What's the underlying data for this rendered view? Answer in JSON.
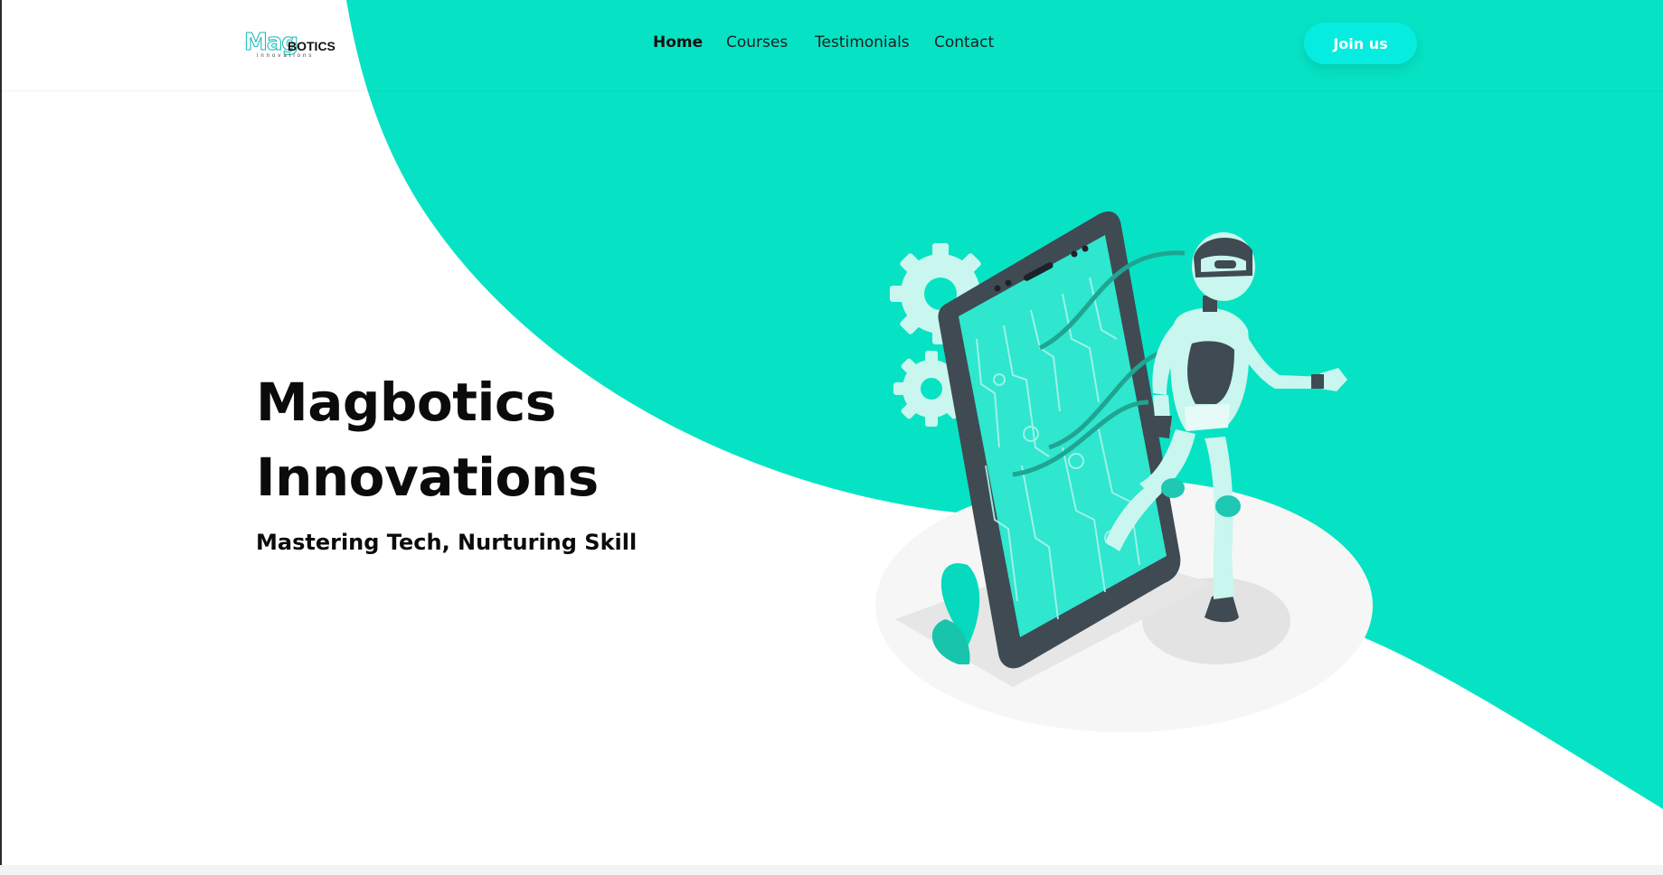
{
  "brand": {
    "logo_main": "Mag",
    "logo_suffix": "BOTICS",
    "logo_tagline": "innovations"
  },
  "nav": {
    "items": [
      {
        "label": "Home",
        "active": true
      },
      {
        "label": "Courses",
        "active": false
      },
      {
        "label": "Testimonials",
        "active": false
      },
      {
        "label": "Contact",
        "active": false
      }
    ]
  },
  "header": {
    "cta_label": "Join us"
  },
  "hero": {
    "title_line1": "Magbotics",
    "title_line2": "Innovations",
    "subtitle": "Mastering Tech, Nurturing Skill"
  },
  "colors": {
    "accent": "#06e3c4",
    "button": "#06ece0",
    "text": "#0b0b0b",
    "device_dark": "#3f4a52"
  },
  "icons": {
    "hero_illustration": "robot-with-smartphone-illustration"
  }
}
